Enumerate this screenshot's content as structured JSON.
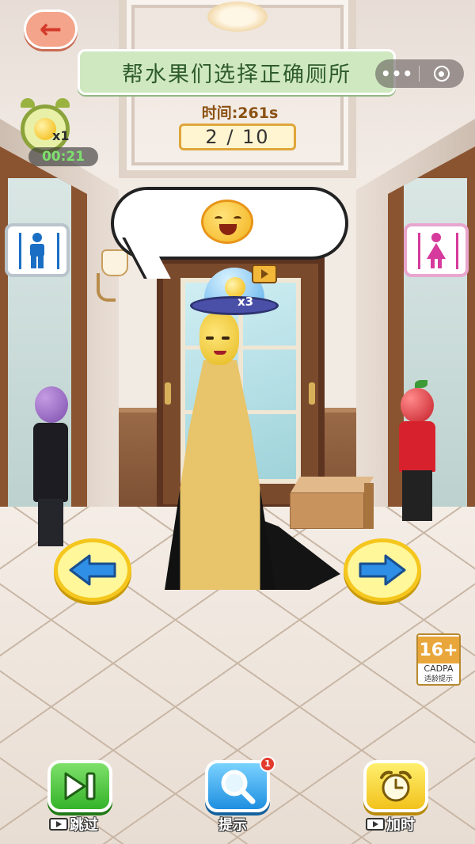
{
  "header": {
    "title": "帮水果们选择正确厕所",
    "back_icon": "arrow-left-icon",
    "menu_dots": "•••",
    "target_icon": "target-icon"
  },
  "clock_powerup": {
    "icon": "alarm-clock-bulb-icon",
    "count": "x1",
    "timer": "00:21"
  },
  "status": {
    "time_label": "时间:261s",
    "progress": "2 / 10",
    "progress_current": 2,
    "progress_total": 10
  },
  "signs": {
    "male_icon": "male-restroom-icon",
    "female_icon": "female-restroom-icon"
  },
  "hint_ufo": {
    "count": "x3",
    "video_icon": "tv-video-icon"
  },
  "emoji": "grinning-face",
  "age_rating": {
    "age": "16+",
    "system": "CADPA",
    "note": "适龄提示"
  },
  "actions": {
    "skip_label": "跳过",
    "hint_label": "提示",
    "hint_badge": "1",
    "addtime_label": "加时"
  },
  "colors": {
    "title_banner": "#cfe8c0",
    "timer_text": "#7ee06c",
    "skip_button": "#35b32a",
    "hint_button": "#1f8fe0",
    "addtime_button": "#f2c21c",
    "male_sign": "#1a6fc4",
    "female_sign": "#d63a9c"
  }
}
